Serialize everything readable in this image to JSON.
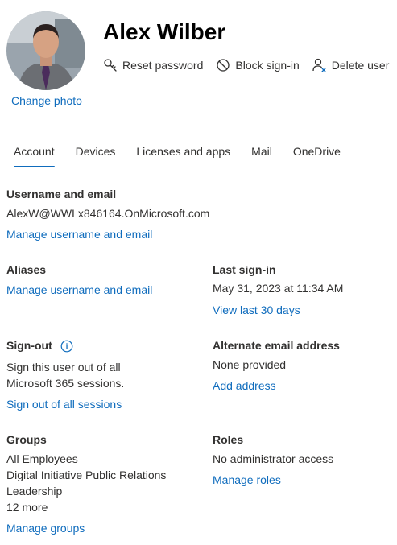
{
  "header": {
    "user_name": "Alex Wilber",
    "change_photo": "Change photo",
    "actions": {
      "reset_password": "Reset password",
      "block_signin": "Block sign-in",
      "delete_user": "Delete user"
    }
  },
  "tabs": [
    "Account",
    "Devices",
    "Licenses and apps",
    "Mail",
    "OneDrive"
  ],
  "active_tab": "Account",
  "username_section": {
    "label": "Username and email",
    "value": "AlexW@WWLx846164.OnMicrosoft.com",
    "link": "Manage username and email"
  },
  "aliases": {
    "label": "Aliases",
    "link": "Manage username and email"
  },
  "last_signin": {
    "label": "Last sign-in",
    "value": "May 31, 2023 at 11:34 AM",
    "link": "View last 30 days"
  },
  "signout": {
    "label": "Sign-out",
    "line1": "Sign this user out of all",
    "line2": "Microsoft 365 sessions.",
    "link": "Sign out of all sessions"
  },
  "alt_email": {
    "label": "Alternate email address",
    "value": "None provided",
    "link": "Add address"
  },
  "groups": {
    "label": "Groups",
    "items": [
      "All Employees",
      "Digital Initiative Public Relations",
      "Leadership",
      "12 more"
    ],
    "link": "Manage groups"
  },
  "roles": {
    "label": "Roles",
    "value": "No administrator access",
    "link": "Manage roles"
  },
  "colors": {
    "accent": "#0f6cbd",
    "text": "#323130"
  }
}
